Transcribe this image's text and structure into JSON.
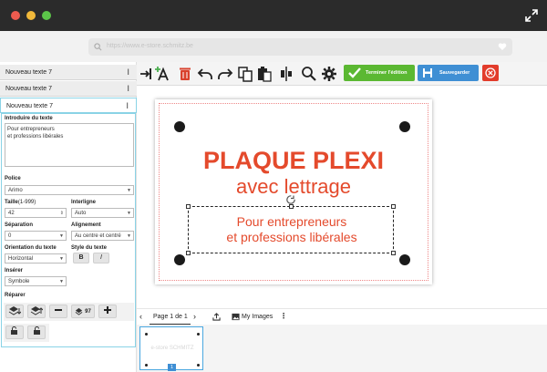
{
  "browser": {
    "url": "https://www.e-store.schmitz.be"
  },
  "layers": [
    {
      "label": "Nouveau texte 7"
    },
    {
      "label": "Nouveau texte 7"
    },
    {
      "label": "Nouveau texte 7"
    }
  ],
  "editor": {
    "intro_label": "Introduire du texte",
    "text_value": "Pour entrepreneurs\net professions libérales",
    "font_label": "Police",
    "font_value": "Arimo",
    "size_label": "Taille",
    "size_range": "(1-999)",
    "size_value": "42",
    "line_spacing_label": "Interligne",
    "line_spacing_value": "Auto",
    "separation_label": "Séparation",
    "separation_value": "0",
    "alignment_label": "Alignement",
    "alignment_value": "Au centre et centré",
    "orientation_label": "Orientation du texte",
    "orientation_value": "Horizontal",
    "style_label": "Style du texte",
    "bold_label": "B",
    "italic_label": "I",
    "insert_label": "Insérer",
    "insert_value": "Symbole",
    "repair_label": "Réparer",
    "layer_count": "97"
  },
  "toolbar": {
    "finish_label": "Terminer l'édition",
    "save_label": "Sauvegarder"
  },
  "canvas": {
    "title_line1": "PLAQUE PLEXI",
    "title_line2": "avec lettrage",
    "selected_line1": "Pour entrepreneurs",
    "selected_line2": "et professions libérales",
    "text_color": "#e44a2c"
  },
  "pages": {
    "page_label": "Page 1 de 1",
    "images_label": "My Images",
    "thumb_watermark": "e-store SCHMITZ",
    "thumb_number": "1"
  },
  "colors": {
    "finish": "#5bb832",
    "save": "#3f8fd4",
    "close": "#e23c2b",
    "accent_border": "#8ad3e6"
  }
}
